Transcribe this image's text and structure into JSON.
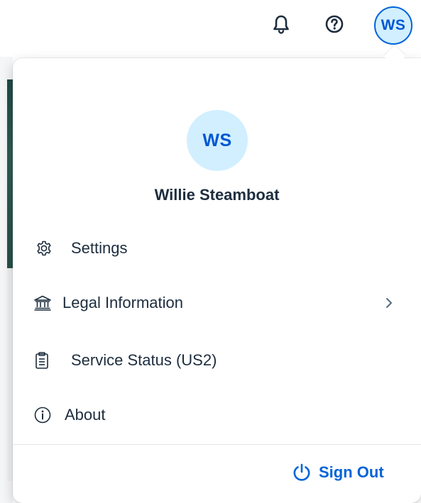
{
  "shellbar": {
    "notifications_icon": "bell-icon",
    "help_icon": "help-circle-icon",
    "avatar_initials": "WS"
  },
  "user_menu": {
    "avatar_initials": "WS",
    "user_name": "Willie Steamboat",
    "items": [
      {
        "label": "Settings",
        "icon": "gear-icon",
        "has_submenu": false
      },
      {
        "label": "Legal Information",
        "icon": "institution-icon",
        "has_submenu": true
      },
      {
        "label": "Service Status (US2)",
        "icon": "clipboard-icon",
        "has_submenu": false
      },
      {
        "label": "About",
        "icon": "info-icon",
        "has_submenu": false
      }
    ],
    "sign_out_label": "Sign Out",
    "sign_out_icon": "power-icon"
  },
  "colors": {
    "accent": "#0064d9",
    "avatar_bg": "#d1efff",
    "text": "#1d2d3e"
  }
}
